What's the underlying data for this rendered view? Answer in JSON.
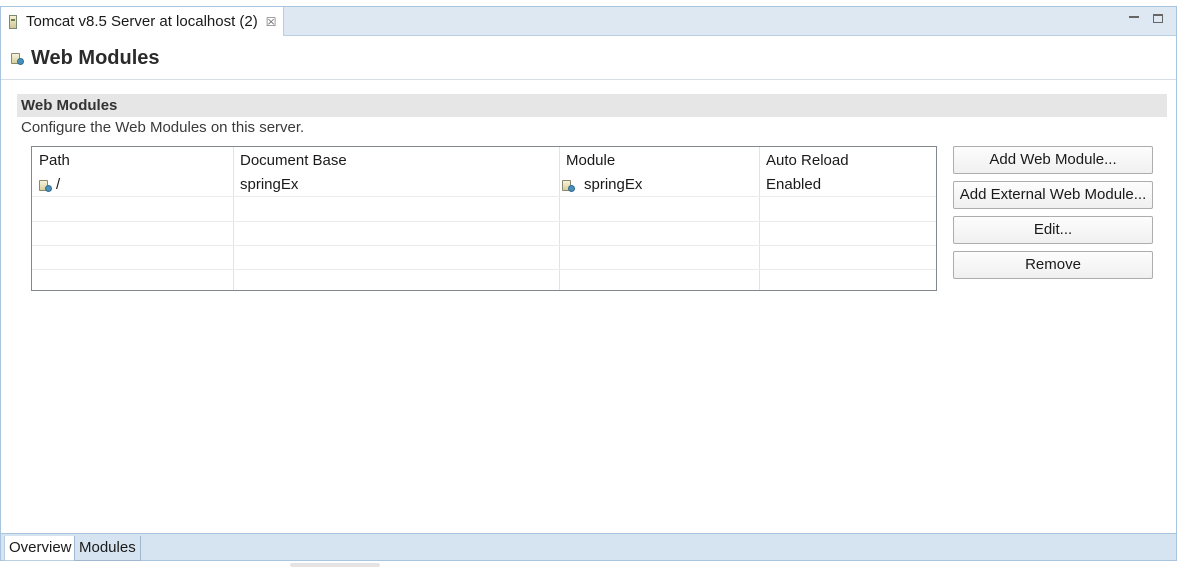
{
  "editor_tab": {
    "title": "Tomcat v8.5 Server at localhost (2)",
    "close_glyph": "☒",
    "icon": "server-icon"
  },
  "window_controls": {
    "minimize_icon": "minimize-icon",
    "maximize_icon": "maximize-icon"
  },
  "form": {
    "title": "Web Modules",
    "icon": "web-module-icon"
  },
  "section": {
    "title": "Web Modules",
    "description": "Configure the Web Modules on this server."
  },
  "table": {
    "columns": [
      "Path",
      "Document Base",
      "Module",
      "Auto Reload"
    ],
    "rows": [
      {
        "path": "/",
        "document_base": "springEx",
        "module": "springEx",
        "auto_reload": "Enabled"
      }
    ]
  },
  "buttons": {
    "add_web_module": "Add Web Module...",
    "add_external_web_module": "Add External Web Module...",
    "edit": "Edit...",
    "remove": "Remove"
  },
  "bottom_tabs": [
    {
      "label": "Overview"
    },
    {
      "label": "Modules"
    }
  ],
  "colors": {
    "tabbar_bg": "#dde8f3",
    "section_bar_bg": "#e6e6e6",
    "bottom_tabs_bg": "#d6e4f1"
  }
}
